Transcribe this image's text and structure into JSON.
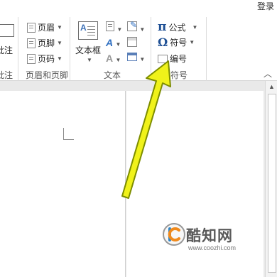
{
  "window": {
    "login_label": "登录"
  },
  "ribbon": {
    "comment_group": {
      "button_label": "批注",
      "group_label": "批注"
    },
    "header_footer": {
      "header_label": "页眉",
      "footer_label": "页脚",
      "page_number_label": "页码",
      "group_label": "页眉和页脚"
    },
    "text": {
      "textbox_label": "文本框",
      "group_label": "文本"
    },
    "symbols": {
      "equation_glyph": "π",
      "equation_label": "公式",
      "symbol_glyph": "Ω",
      "symbol_label": "符号",
      "number_label": "编号",
      "group_label": "符号"
    }
  },
  "watermark": {
    "brand": "酷知网",
    "url": "www.coozhi.com"
  },
  "colors": {
    "arrow": "#f0f21a",
    "arrow_outline": "#7d8d00"
  }
}
